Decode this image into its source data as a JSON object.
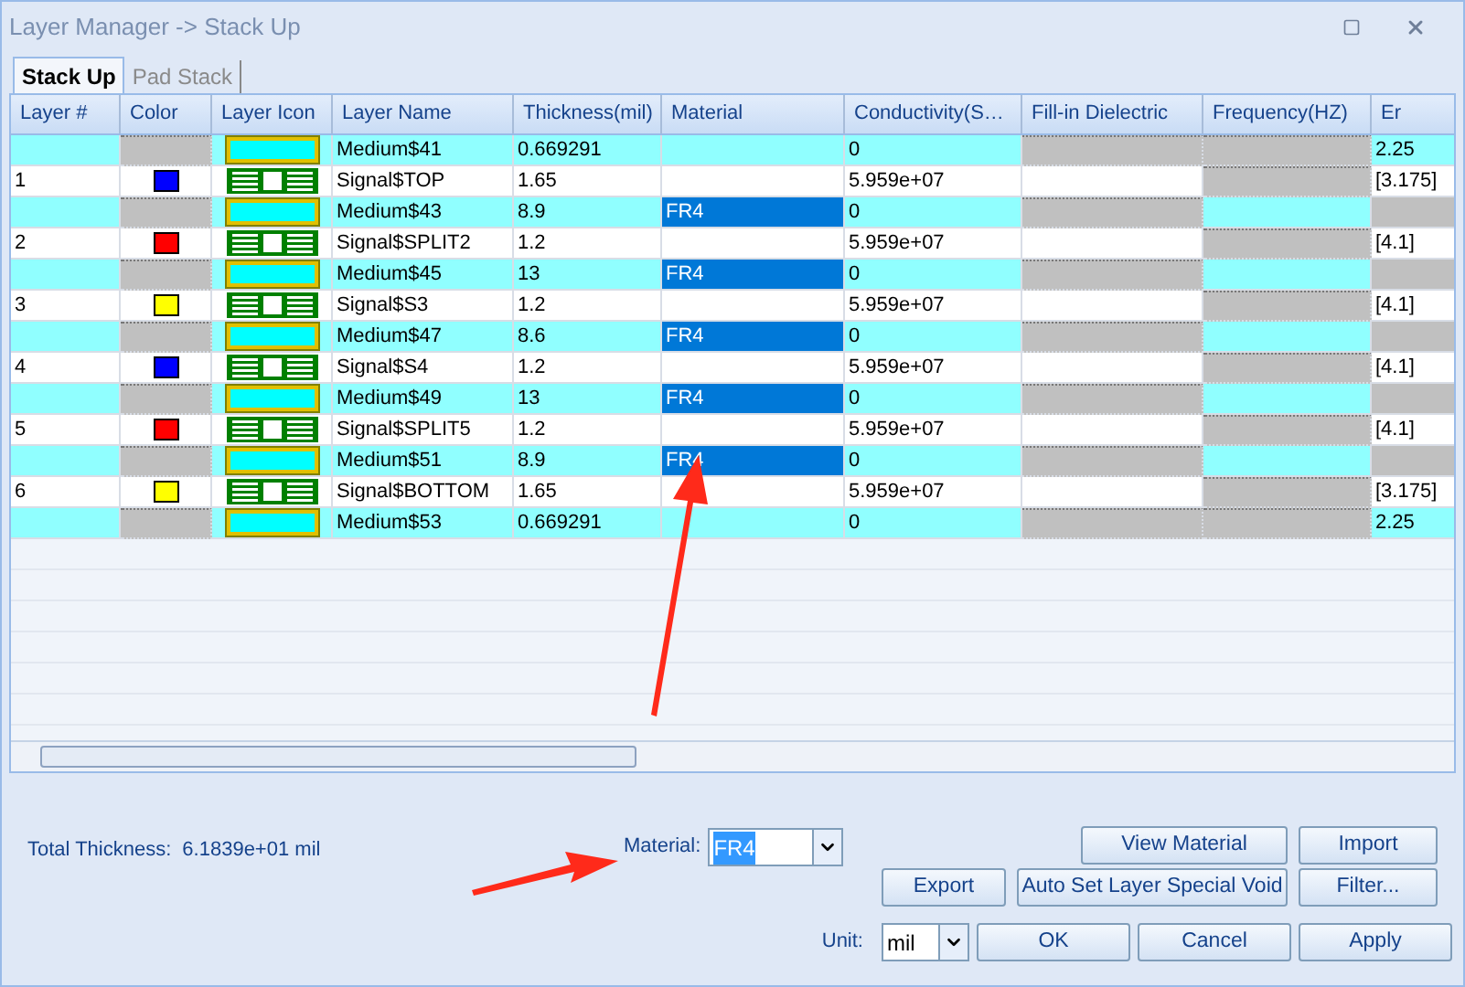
{
  "window": {
    "title": "Layer Manager -> Stack Up"
  },
  "tabs": [
    {
      "label": "Stack Up",
      "selected": true
    },
    {
      "label": "Pad Stack",
      "selected": false
    }
  ],
  "table": {
    "columns": [
      "Layer #",
      "Color",
      "Layer Icon",
      "Layer Name",
      "Thickness(mil)",
      "Material",
      "Conductivity(S…",
      "Fill-in Dielectric",
      "Frequency(HZ)",
      "Er"
    ],
    "rows": [
      {
        "kind": "medium",
        "number": "",
        "name": "Medium$41",
        "thickness": "0.669291",
        "material": "",
        "conductivity": "0",
        "er": "2.25"
      },
      {
        "kind": "signal",
        "number": "1",
        "color": "#0000ff",
        "name": "Signal$TOP",
        "thickness": "1.65",
        "material": "",
        "conductivity": "5.959e+07",
        "er": "[3.175]"
      },
      {
        "kind": "medium",
        "number": "",
        "name": "Medium$43",
        "thickness": "8.9",
        "material": "FR4",
        "conductivity": "0",
        "er": ""
      },
      {
        "kind": "signal",
        "number": "2",
        "color": "#ff0000",
        "name": "Signal$SPLIT2",
        "thickness": "1.2",
        "material": "",
        "conductivity": "5.959e+07",
        "er": "[4.1]"
      },
      {
        "kind": "medium",
        "number": "",
        "name": "Medium$45",
        "thickness": "13",
        "material": "FR4",
        "conductivity": "0",
        "er": ""
      },
      {
        "kind": "signal",
        "number": "3",
        "color": "#ffff00",
        "name": "Signal$S3",
        "thickness": "1.2",
        "material": "",
        "conductivity": "5.959e+07",
        "er": "[4.1]"
      },
      {
        "kind": "medium",
        "number": "",
        "name": "Medium$47",
        "thickness": "8.6",
        "material": "FR4",
        "conductivity": "0",
        "er": ""
      },
      {
        "kind": "signal",
        "number": "4",
        "color": "#0000ff",
        "name": "Signal$S4",
        "thickness": "1.2",
        "material": "",
        "conductivity": "5.959e+07",
        "er": "[4.1]"
      },
      {
        "kind": "medium",
        "number": "",
        "name": "Medium$49",
        "thickness": "13",
        "material": "FR4",
        "conductivity": "0",
        "er": ""
      },
      {
        "kind": "signal",
        "number": "5",
        "color": "#ff0000",
        "name": "Signal$SPLIT5",
        "thickness": "1.2",
        "material": "",
        "conductivity": "5.959e+07",
        "er": "[4.1]"
      },
      {
        "kind": "medium",
        "number": "",
        "name": "Medium$51",
        "thickness": "8.9",
        "material": "FR4",
        "conductivity": "0",
        "er": ""
      },
      {
        "kind": "signal",
        "number": "6",
        "color": "#ffff00",
        "name": "Signal$BOTTOM",
        "thickness": "1.65",
        "material": "",
        "conductivity": "5.959e+07",
        "er": "[3.175]"
      },
      {
        "kind": "medium",
        "number": "",
        "name": "Medium$53",
        "thickness": "0.669291",
        "material": "",
        "conductivity": "0",
        "er": "2.25"
      }
    ]
  },
  "total_thickness": {
    "label": "Total Thickness:",
    "value": "6.1839e+01 mil"
  },
  "material": {
    "label": "Material:",
    "value": "FR4"
  },
  "buttons_top": [
    "View Material",
    "Import"
  ],
  "buttons_middle": [
    "Export",
    "Auto Set Layer Special Void",
    "Filter..."
  ],
  "unit": {
    "label": "Unit:",
    "value": "mil"
  },
  "buttons_bottom": [
    "OK",
    "Cancel",
    "Apply"
  ]
}
